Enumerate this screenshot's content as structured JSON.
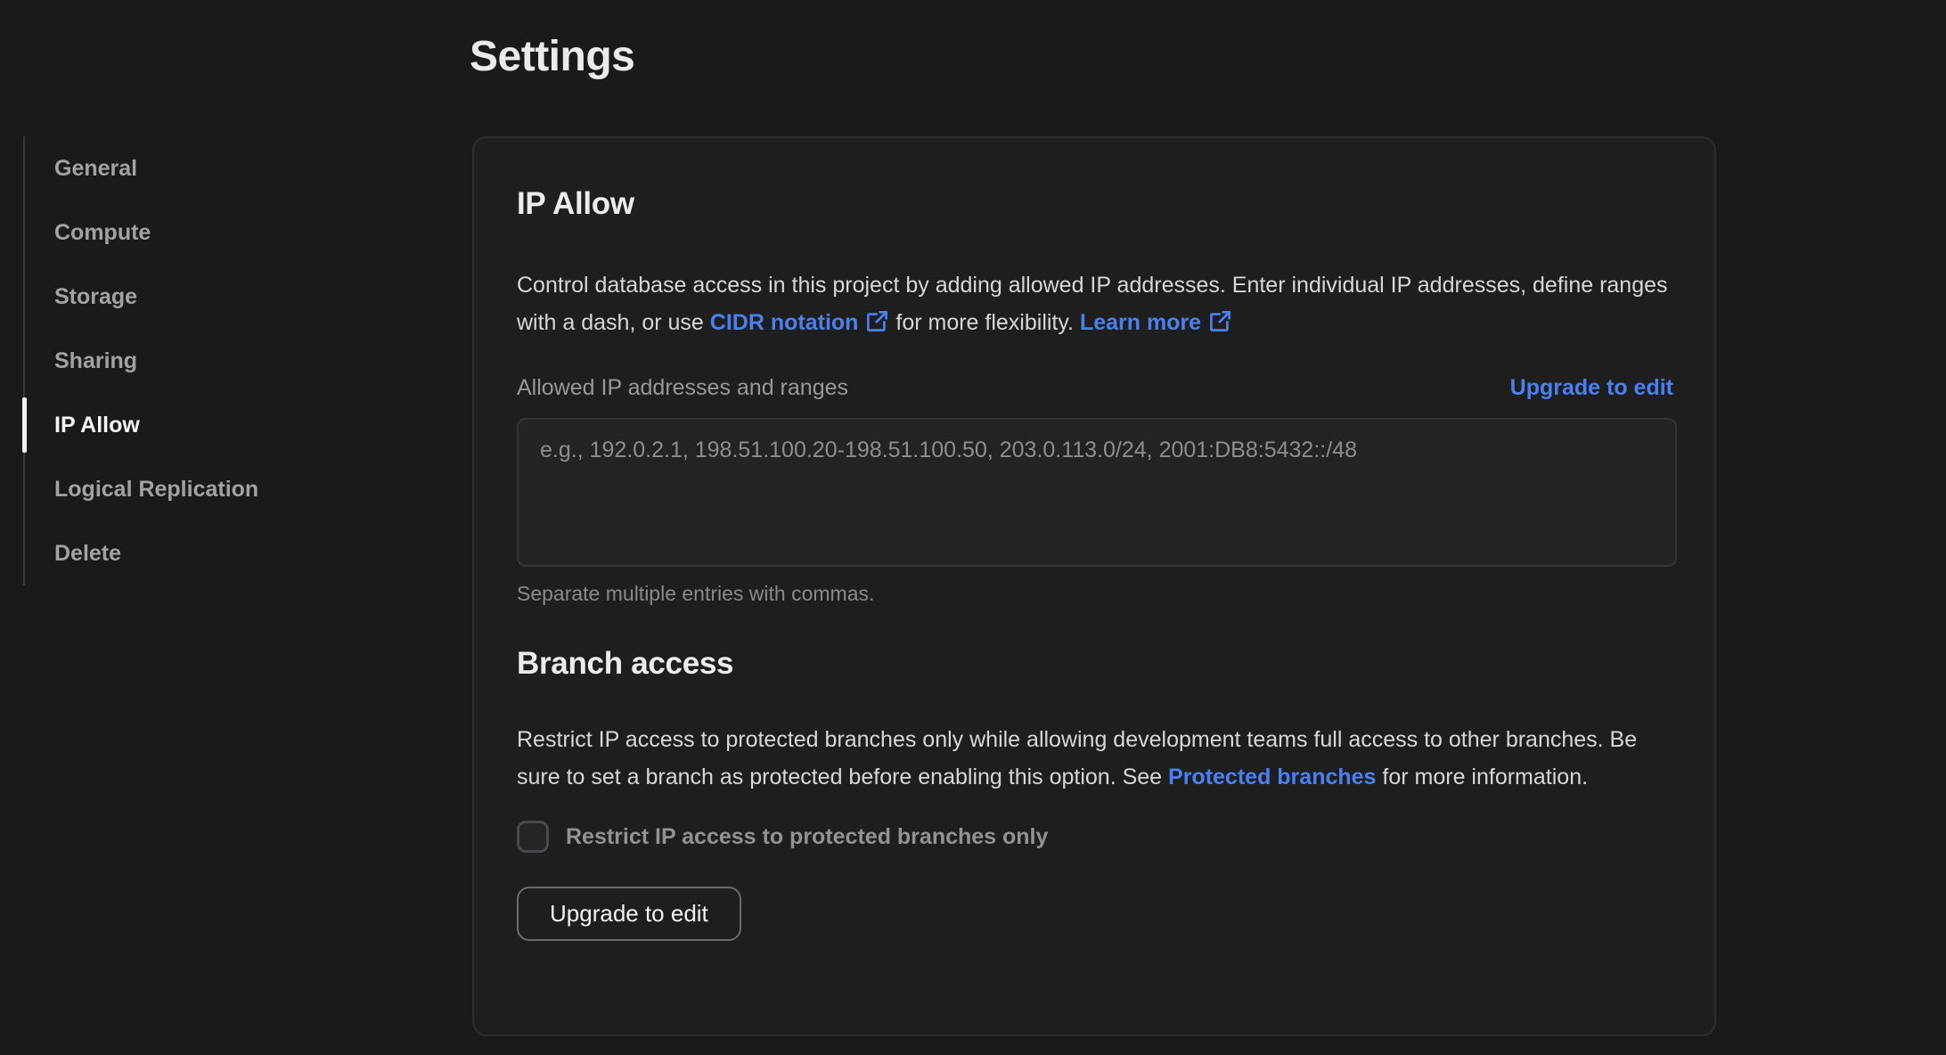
{
  "page": {
    "title": "Settings"
  },
  "colors": {
    "accent_blue": "#4a80f0",
    "page_bg": "#1a1a1b",
    "card_bg": "#1e1e1f"
  },
  "sidebar": {
    "items": [
      {
        "label": "General",
        "active": false
      },
      {
        "label": "Compute",
        "active": false
      },
      {
        "label": "Storage",
        "active": false
      },
      {
        "label": "Sharing",
        "active": false
      },
      {
        "label": "IP Allow",
        "active": true
      },
      {
        "label": "Logical Replication",
        "active": false
      },
      {
        "label": "Delete",
        "active": false
      }
    ]
  },
  "ip_allow": {
    "heading": "IP Allow",
    "desc_part1": "Control database access in this project by adding allowed IP addresses. Enter individual IP addresses, define ranges with a dash, or use ",
    "cidr_link_label": "CIDR notation",
    "desc_part2": " for more flexibility. ",
    "learn_more_label": "Learn more",
    "field_label": "Allowed IP addresses and ranges",
    "upgrade_link_label": "Upgrade to edit",
    "textarea_placeholder": "e.g., 192.0.2.1, 198.51.100.20-198.51.100.50, 203.0.113.0/24, 2001:DB8:5432::/48",
    "helper_text": "Separate multiple entries with commas."
  },
  "branch_access": {
    "heading": "Branch access",
    "desc_part1": "Restrict IP access to protected branches only while allowing development teams full access to other branches. Be sure to set a branch as protected before enabling this option. See ",
    "protected_link_label": "Protected branches",
    "desc_part2": " for more information.",
    "checkbox_label": "Restrict IP access to protected branches only",
    "checkbox_checked": false,
    "button_label": "Upgrade to edit"
  }
}
